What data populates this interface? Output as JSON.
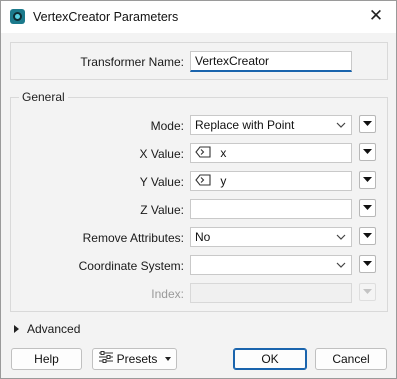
{
  "window": {
    "title": "VertexCreator Parameters",
    "close_glyph": "✕"
  },
  "transformer": {
    "label": "Transformer Name:",
    "value": "VertexCreator"
  },
  "general": {
    "label": "General",
    "mode": {
      "label": "Mode:",
      "value": "Replace with Point"
    },
    "x_value": {
      "label": "X Value:",
      "value": "x",
      "icon": "attribute-icon"
    },
    "y_value": {
      "label": "Y Value:",
      "value": "y",
      "icon": "attribute-icon"
    },
    "z_value": {
      "label": "Z Value:",
      "value": ""
    },
    "remove_attributes": {
      "label": "Remove Attributes:",
      "value": "No"
    },
    "coordinate_system": {
      "label": "Coordinate System:",
      "value": ""
    },
    "index": {
      "label": "Index:",
      "value": ""
    }
  },
  "advanced": {
    "label": "Advanced"
  },
  "footer": {
    "help": "Help",
    "presets": "Presets",
    "ok": "OK",
    "cancel": "Cancel"
  },
  "colors": {
    "accent": "#1a64ad",
    "app_icon": "#1c7a8c"
  }
}
